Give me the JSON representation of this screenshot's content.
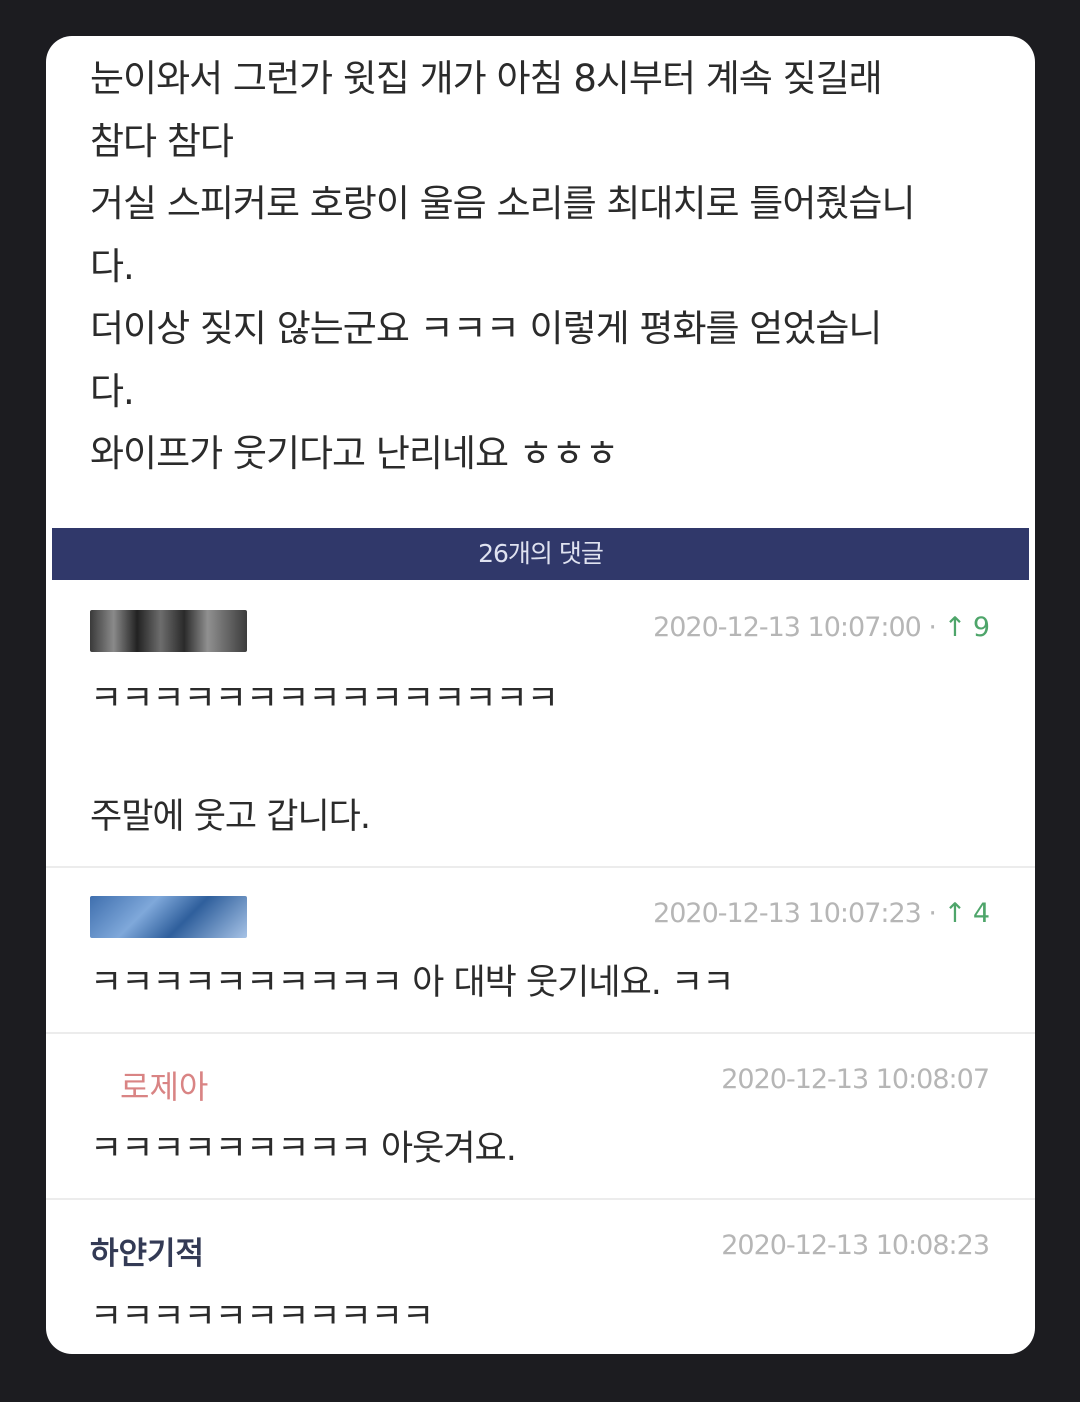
{
  "post": {
    "lines": [
      "눈이와서 그런가 윗집 개가 아침 8시부터 계속 짖길래",
      "참다 참다",
      "거실 스피커로 호랑이 울음 소리를 최대치로 틀어줬습니",
      "다.",
      "더이상 짖지 않는군요 ㅋㅋㅋ 이렇게 평화를 얻었습니",
      "다.",
      "와이프가 웃기다고 난리네요 ㅎㅎㅎ"
    ]
  },
  "comments_header": "26개의 댓글",
  "comments": [
    {
      "author_type": "image-avatar",
      "timestamp": "2020-12-13 10:07:00",
      "upvote_icon": "arrow-up-icon",
      "upvotes": "9",
      "text": [
        "ㅋㅋㅋㅋㅋㅋㅋㅋㅋㅋㅋㅋㅋㅋㅋ",
        "주말에 웃고 갑니다."
      ]
    },
    {
      "author_type": "image-avatar",
      "timestamp": "2020-12-13 10:07:23",
      "upvote_icon": "arrow-up-icon",
      "upvotes": "4",
      "text": [
        "ㅋㅋㅋㅋㅋㅋㅋㅋㅋㅋ 아 대박 웃기네요. ㅋㅋ"
      ]
    },
    {
      "author": "로제아",
      "timestamp": "2020-12-13 10:08:07",
      "text": [
        "ㅋㅋㅋㅋㅋㅋㅋㅋㅋ 아웃겨요."
      ]
    },
    {
      "author": "하얀기적",
      "timestamp": "2020-12-13 10:08:23",
      "text": [
        "ㅋㅋㅋㅋㅋㅋㅋㅋㅋㅋㅋ"
      ]
    }
  ],
  "colors": {
    "background": "#1c1c20",
    "card": "#ffffff",
    "comment_bar": "#30386a",
    "upvote": "#4ea56a",
    "meta": "#b6b6b6"
  }
}
